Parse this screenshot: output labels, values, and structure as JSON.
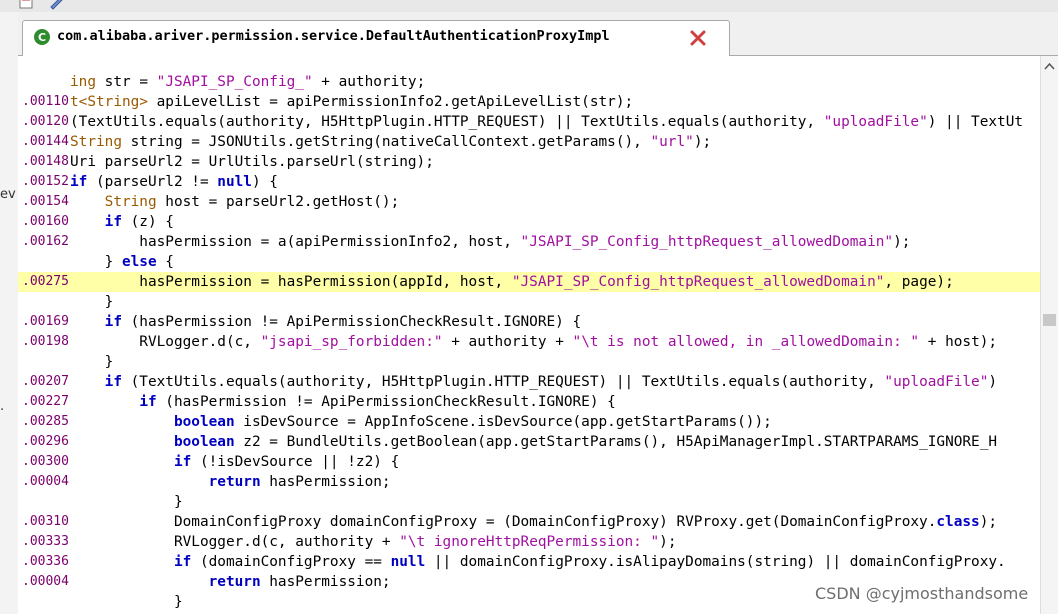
{
  "tab": {
    "title": "com.alibaba.ariver.permission.service.DefaultAuthenticationProxyImpl"
  },
  "left_strip_fragments": [
    "ev",
    "."
  ],
  "lines": [
    {
      "ln": "",
      "segs": [
        [
          "ty",
          "ing"
        ],
        [
          "n",
          " str = "
        ],
        [
          "str",
          "\"JSAPI_SP_Config_\""
        ],
        [
          "n",
          " + authority;"
        ]
      ]
    },
    {
      "ln": ".00110",
      "segs": [
        [
          "ty",
          "t<String>"
        ],
        [
          "n",
          " apiLevelList = apiPermissionInfo2.getApiLevelList(str);"
        ]
      ]
    },
    {
      "ln": ".00120",
      "segs": [
        [
          "n",
          "(TextUtils.equals(authority, H5HttpPlugin.HTTP_REQUEST) || TextUtils.equals(authority, "
        ],
        [
          "str",
          "\"uploadFile\""
        ],
        [
          "n",
          ") || TextUt"
        ]
      ]
    },
    {
      "ln": ".00144",
      "segs": [
        [
          "ty",
          "String"
        ],
        [
          "n",
          " string = JSONUtils.getString(nativeCallContext.getParams(), "
        ],
        [
          "str",
          "\"url\""
        ],
        [
          "n",
          ");"
        ]
      ]
    },
    {
      "ln": ".00148",
      "segs": [
        [
          "n",
          "Uri parseUrl2 = UrlUtils.parseUrl(string);"
        ]
      ]
    },
    {
      "ln": ".00152",
      "segs": [
        [
          "kw",
          "if"
        ],
        [
          "n",
          " (parseUrl2 != "
        ],
        [
          "kw",
          "null"
        ],
        [
          "n",
          ") {"
        ]
      ]
    },
    {
      "ln": ".00154",
      "segs": [
        [
          "n",
          "    "
        ],
        [
          "ty",
          "String"
        ],
        [
          "n",
          " host = parseUrl2.getHost();"
        ]
      ]
    },
    {
      "ln": ".00160",
      "segs": [
        [
          "n",
          "    "
        ],
        [
          "kw",
          "if"
        ],
        [
          "n",
          " (z) {"
        ]
      ]
    },
    {
      "ln": ".00162",
      "segs": [
        [
          "n",
          "        hasPermission = a(apiPermissionInfo2, host, "
        ],
        [
          "str",
          "\"JSAPI_SP_Config_httpRequest_allowedDomain\""
        ],
        [
          "n",
          ");"
        ]
      ]
    },
    {
      "ln": "",
      "segs": [
        [
          "n",
          "    } "
        ],
        [
          "kw",
          "else"
        ],
        [
          "n",
          " {"
        ]
      ]
    },
    {
      "ln": ".00275",
      "hl": true,
      "segs": [
        [
          "n",
          "        hasPermission = hasPermission(appId, host, "
        ],
        [
          "str",
          "\"JSAPI_SP_Config_httpRequest_allowedDomain\""
        ],
        [
          "n",
          ", page);"
        ]
      ]
    },
    {
      "ln": "",
      "segs": [
        [
          "n",
          "    }"
        ]
      ]
    },
    {
      "ln": ".00169",
      "segs": [
        [
          "n",
          "    "
        ],
        [
          "kw",
          "if"
        ],
        [
          "n",
          " (hasPermission != ApiPermissionCheckResult.IGNORE) {"
        ]
      ]
    },
    {
      "ln": ".00198",
      "segs": [
        [
          "n",
          "        RVLogger.d(c, "
        ],
        [
          "str",
          "\"jsapi_sp_forbidden:\""
        ],
        [
          "n",
          " + authority + "
        ],
        [
          "str",
          "\"\\t is not allowed, in _allowedDomain: \""
        ],
        [
          "n",
          " + host);"
        ]
      ]
    },
    {
      "ln": "",
      "segs": [
        [
          "n",
          "    }"
        ]
      ]
    },
    {
      "ln": ".00207",
      "segs": [
        [
          "n",
          "    "
        ],
        [
          "kw",
          "if"
        ],
        [
          "n",
          " (TextUtils.equals(authority, H5HttpPlugin.HTTP_REQUEST) || TextUtils.equals(authority, "
        ],
        [
          "str",
          "\"uploadFile\""
        ],
        [
          "n",
          ")"
        ]
      ]
    },
    {
      "ln": ".00227",
      "segs": [
        [
          "n",
          "        "
        ],
        [
          "kw",
          "if"
        ],
        [
          "n",
          " (hasPermission != ApiPermissionCheckResult.IGNORE) {"
        ]
      ]
    },
    {
      "ln": ".00285",
      "segs": [
        [
          "n",
          "            "
        ],
        [
          "kw",
          "boolean"
        ],
        [
          "n",
          " isDevSource = AppInfoScene.isDevSource(app.getStartParams());"
        ]
      ]
    },
    {
      "ln": ".00296",
      "segs": [
        [
          "n",
          "            "
        ],
        [
          "kw",
          "boolean"
        ],
        [
          "n",
          " z2 = BundleUtils.getBoolean(app.getStartParams(), H5ApiManagerImpl.STARTPARAMS_IGNORE_H"
        ]
      ]
    },
    {
      "ln": ".00300",
      "segs": [
        [
          "n",
          "            "
        ],
        [
          "kw",
          "if"
        ],
        [
          "n",
          " (!isDevSource || !z2) {"
        ]
      ]
    },
    {
      "ln": ".00004",
      "segs": [
        [
          "n",
          "                "
        ],
        [
          "kw",
          "return"
        ],
        [
          "n",
          " hasPermission;"
        ]
      ]
    },
    {
      "ln": "",
      "segs": [
        [
          "n",
          "            }"
        ]
      ]
    },
    {
      "ln": ".00310",
      "segs": [
        [
          "n",
          "            DomainConfigProxy domainConfigProxy = (DomainConfigProxy) RVProxy.get(DomainConfigProxy."
        ],
        [
          "kw",
          "class"
        ],
        [
          "n",
          ");"
        ]
      ]
    },
    {
      "ln": ".00333",
      "segs": [
        [
          "n",
          "            RVLogger.d(c, authority + "
        ],
        [
          "str",
          "\"\\t ignoreHttpReqPermission: \""
        ],
        [
          "n",
          ");"
        ]
      ]
    },
    {
      "ln": ".00336",
      "segs": [
        [
          "n",
          "            "
        ],
        [
          "kw",
          "if"
        ],
        [
          "n",
          " (domainConfigProxy == "
        ],
        [
          "kw",
          "null"
        ],
        [
          "n",
          " || domainConfigProxy.isAlipayDomains(string) || domainConfigProxy."
        ]
      ]
    },
    {
      "ln": ".00004",
      "segs": [
        [
          "n",
          "                "
        ],
        [
          "kw",
          "return"
        ],
        [
          "n",
          " hasPermission;"
        ]
      ]
    },
    {
      "ln": "",
      "segs": [
        [
          "n",
          "            }"
        ]
      ]
    }
  ],
  "watermark": "CSDN @cyjmosthandsome"
}
